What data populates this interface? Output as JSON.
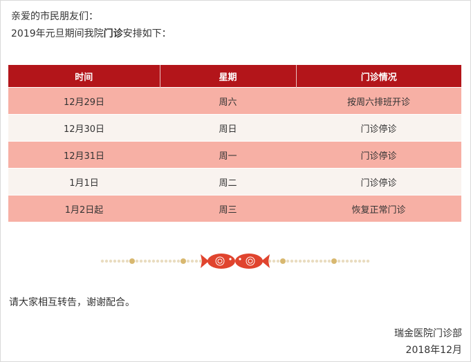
{
  "intro": {
    "greeting": "亲爱的市民朋友们：",
    "line_prefix": "2019年元旦期间我院",
    "line_bold": "门诊",
    "line_suffix": "安排如下："
  },
  "table": {
    "headers": [
      "时间",
      "星期",
      "门诊情况"
    ],
    "rows": [
      {
        "date": "12月29日",
        "weekday": "周六",
        "status": "按周六排班开诊"
      },
      {
        "date": "12月30日",
        "weekday": "周日",
        "status": "门诊停诊"
      },
      {
        "date": "12月31日",
        "weekday": "周一",
        "status": "门诊停诊"
      },
      {
        "date": "1月1日",
        "weekday": "周二",
        "status": "门诊停诊"
      },
      {
        "date": "1月2日起",
        "weekday": "周三",
        "status": "恢复正常门诊"
      }
    ]
  },
  "divider": {
    "icon": "twin-fish-ornament"
  },
  "notice": "请大家相互转告，谢谢配合。",
  "signature": {
    "department": "瑞金医院门诊部",
    "date": "2018年12月"
  },
  "colors": {
    "header_red": "#b3151a",
    "row_pink": "#f7b0a5",
    "row_light": "#f9f3ef",
    "fish_red": "#e0442e",
    "bead_gold": "#d8b870"
  }
}
